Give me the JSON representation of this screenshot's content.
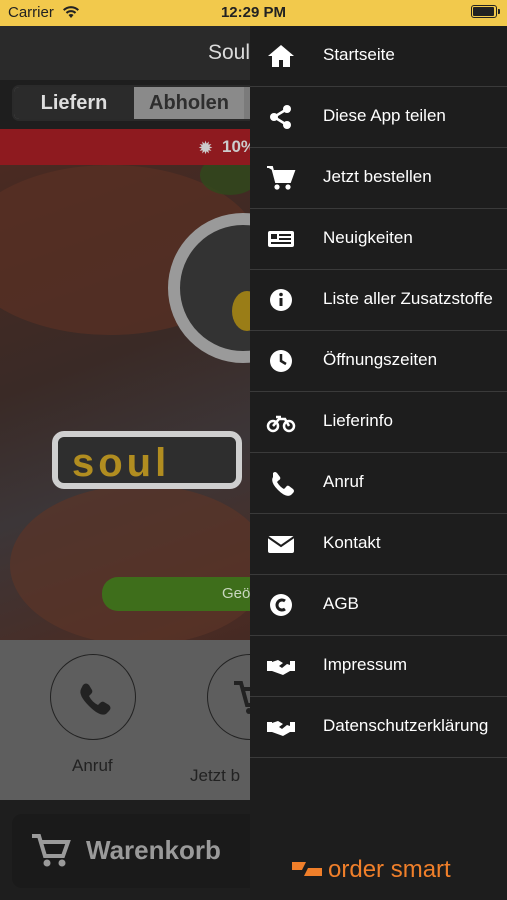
{
  "status_bar": {
    "carrier": "Carrier",
    "time": "12:29 PM",
    "battery_level": 1.0
  },
  "app": {
    "title": "Soul",
    "segments": [
      "Liefern",
      "Abholen"
    ],
    "promo_text": "10%",
    "open_button": "Geö",
    "actions": [
      "Anruf",
      "Jetzt b"
    ],
    "basket_label": "Warenkorb",
    "logo_text": "soul"
  },
  "drawer": {
    "items": [
      {
        "label": "Startseite",
        "icon": "home-icon"
      },
      {
        "label": "Diese App teilen",
        "icon": "share-icon"
      },
      {
        "label": "Jetzt bestellen",
        "icon": "cart-icon"
      },
      {
        "label": "Neuigkeiten",
        "icon": "newspaper-icon"
      },
      {
        "label": "Liste aller Zusatzstoffe",
        "icon": "info-icon"
      },
      {
        "label": "Öffnungszeiten",
        "icon": "clock-icon"
      },
      {
        "label": "Lieferinfo",
        "icon": "motorcycle-icon"
      },
      {
        "label": "Anruf",
        "icon": "phone-icon"
      },
      {
        "label": "Kontakt",
        "icon": "envelope-icon"
      },
      {
        "label": "AGB",
        "icon": "copyright-icon"
      },
      {
        "label": "Impressum",
        "icon": "handshake-icon"
      },
      {
        "label": "Datenschutzerklärung",
        "icon": "handshake-icon"
      }
    ],
    "brand": "order smart"
  },
  "colors": {
    "status_bar": "#f2c94c",
    "drawer_bg": "#1d1d1d",
    "brand_orange": "#f07f2a",
    "promo_red": "#8e1a1f",
    "open_green": "#3e6e1b"
  }
}
